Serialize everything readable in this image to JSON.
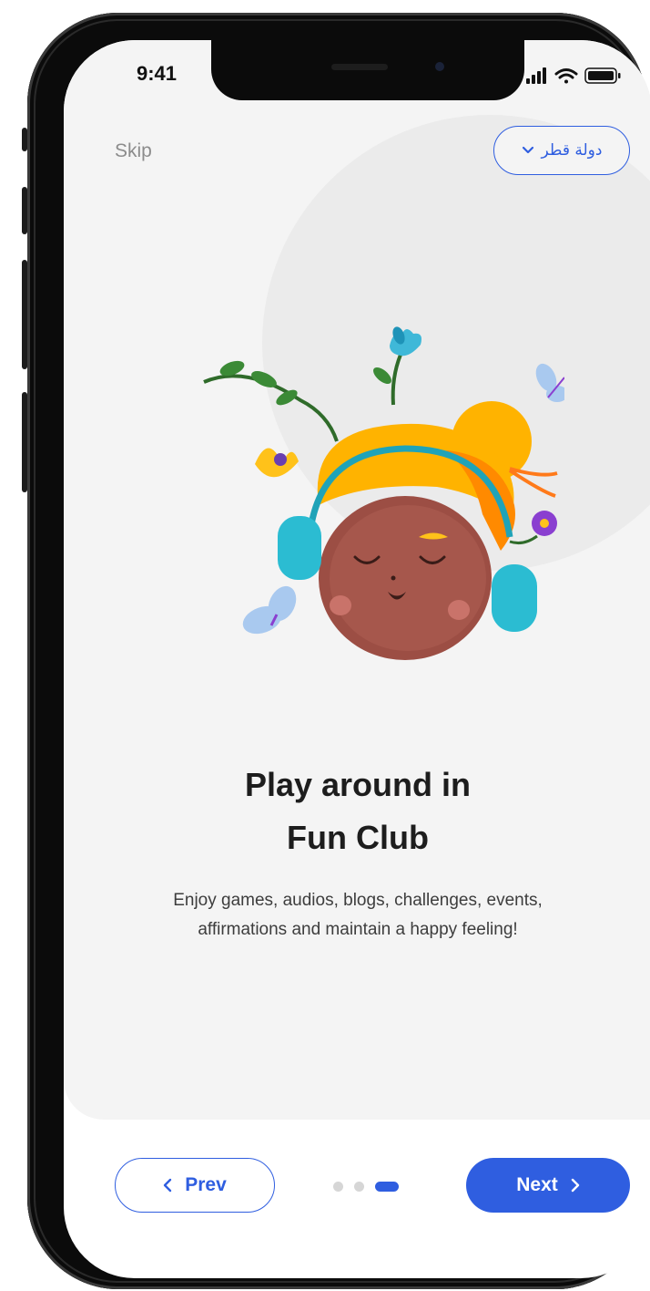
{
  "status_bar": {
    "time": "9:41"
  },
  "header": {
    "skip_label": "Skip",
    "language_label": "دولة قطر"
  },
  "slide": {
    "title_line1": "Play around in",
    "title_line2": "Fun Club",
    "description": "Enjoy games, audios, blogs, challenges, events, affirmations and maintain a happy feeling!"
  },
  "navigation": {
    "prev_label": "Prev",
    "next_label": "Next",
    "page_count": 3,
    "current_page": 3
  },
  "colors": {
    "accent": "#2f5ee0",
    "card_background": "#f4f4f4",
    "muted_text": "#8c8c8c"
  },
  "icons": {
    "prev": "chevron-left-icon",
    "next": "chevron-right-icon",
    "language": "chevron-down-icon"
  }
}
